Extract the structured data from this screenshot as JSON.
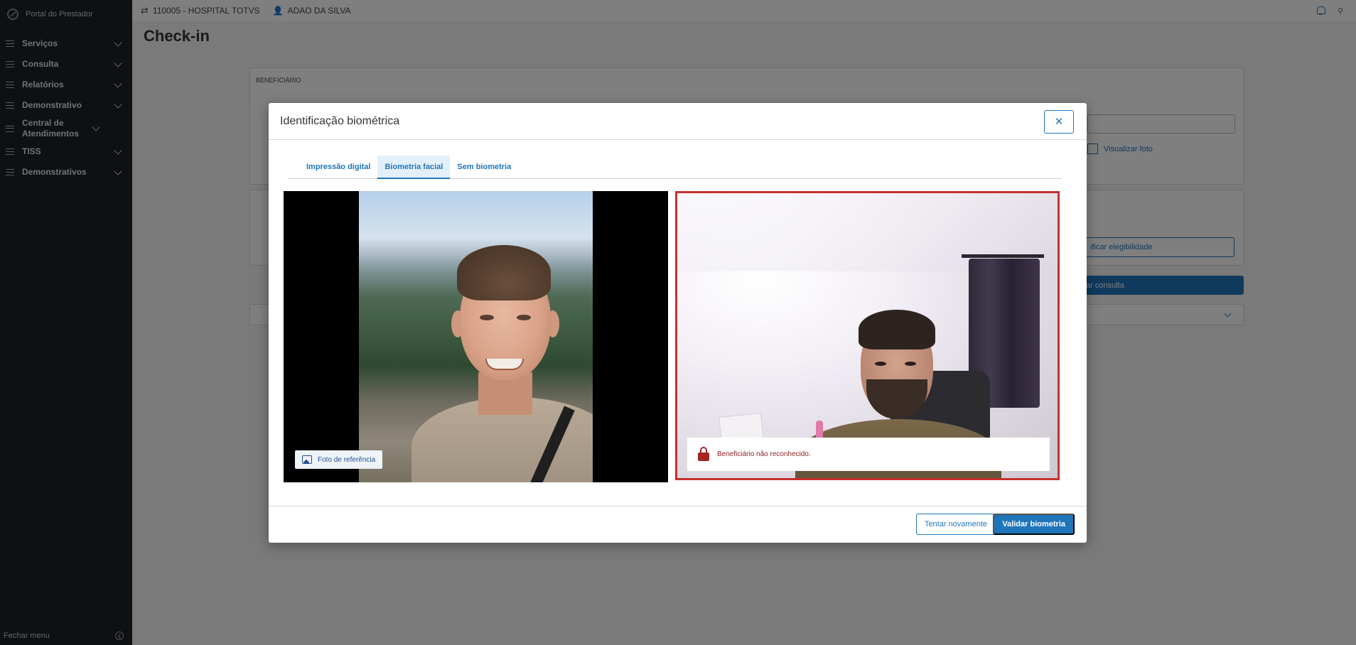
{
  "brand": {
    "name": "Portal do Prestador"
  },
  "sidebar": {
    "items": [
      {
        "label": "Serviços"
      },
      {
        "label": "Consulta"
      },
      {
        "label": "Relatórios"
      },
      {
        "label": "Demonstrativo"
      },
      {
        "label": "Central de Atendimentos"
      },
      {
        "label": "TISS"
      },
      {
        "label": "Demonstrativos"
      }
    ],
    "footer_label": "Fechar menu"
  },
  "topbar": {
    "hospital": "110005 - HOSPITAL TOTVS",
    "user": "ADAO DA SILVA"
  },
  "page": {
    "title": "Check-in",
    "beneficiario_heading": "BENEFICIÁRIO",
    "visualizar_foto": "Visualizar foto",
    "verificar_elegibilidade_partial": "ificar elegibilidade",
    "iniciar_consulta_partial": "ar consulta"
  },
  "modal": {
    "title": "Identificação biométrica",
    "close_icon": "close-icon",
    "tabs": [
      {
        "label": "Impressão digital",
        "active": false
      },
      {
        "label": "Biometria facial",
        "active": true
      },
      {
        "label": "Sem biometria",
        "active": false
      }
    ],
    "reference_badge": "Foto de referência",
    "recognition_message": "Beneficiário não reconhecido.",
    "status_color": "#c7302f",
    "buttons": {
      "retry": "Tentar novamente",
      "validate": "Validar biometria"
    }
  },
  "colors": {
    "accent": "#1f75ba",
    "sidebar_bg": "#1c2024",
    "error": "#c7302f"
  }
}
